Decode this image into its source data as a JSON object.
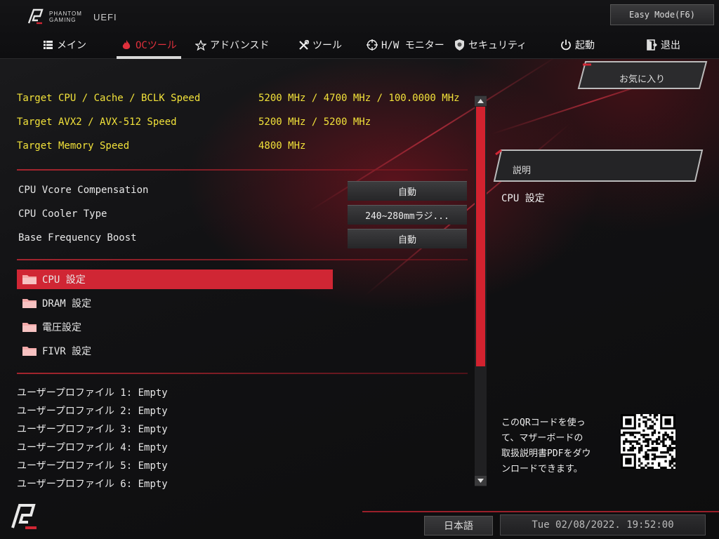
{
  "header": {
    "logo_brand_line1": "PHANTOM",
    "logo_brand_line2": "GAMING",
    "logo_uefi": "UEFI",
    "easy_mode_label": "Easy Mode(F6)"
  },
  "nav": {
    "tabs": [
      {
        "label": "メイン",
        "icon": "list-icon",
        "active": false
      },
      {
        "label": "OCツール",
        "icon": "flame-icon",
        "active": true
      },
      {
        "label": "アドバンスド",
        "icon": "star-icon",
        "active": false
      },
      {
        "label": "ツール",
        "icon": "tools-icon",
        "active": false
      },
      {
        "label": "H/W モニター",
        "icon": "crosshair-icon",
        "active": false
      },
      {
        "label": "セキュリティ",
        "icon": "shield-icon",
        "active": false
      },
      {
        "label": "起動",
        "icon": "power-icon",
        "active": false
      },
      {
        "label": "退出",
        "icon": "exit-icon",
        "active": false
      }
    ]
  },
  "targets": [
    {
      "label": "Target CPU / Cache / BCLK Speed",
      "value": "5200 MHz / 4700 MHz / 100.0000 MHz"
    },
    {
      "label": "Target AVX2 / AVX-512 Speed",
      "value": "5200 MHz / 5200 MHz"
    },
    {
      "label": "Target Memory Speed",
      "value": "4800 MHz"
    }
  ],
  "settings": [
    {
      "label": "CPU Vcore Compensation",
      "value": "自動"
    },
    {
      "label": "CPU Cooler Type",
      "value": "240~280mmラジ..."
    },
    {
      "label": "Base Frequency Boost",
      "value": "自動"
    }
  ],
  "submenus": [
    {
      "label": "CPU 設定",
      "selected": true
    },
    {
      "label": "DRAM 設定",
      "selected": false
    },
    {
      "label": "電圧設定",
      "selected": false
    },
    {
      "label": "FIVR 設定",
      "selected": false
    }
  ],
  "profiles": [
    "ユーザープロファイル 1: Empty",
    "ユーザープロファイル 2: Empty",
    "ユーザープロファイル 3: Empty",
    "ユーザープロファイル 4: Empty",
    "ユーザープロファイル 5: Empty",
    "ユーザープロファイル 6: Empty"
  ],
  "right_panel": {
    "favorites_label": "お気に入り",
    "description_label": "説明",
    "description_text": "CPU 設定",
    "qr_text_lines": [
      "このQRコードを使っ",
      "て、マザーボードの",
      "取扱説明書PDFをダウ",
      "ンロードできます。"
    ]
  },
  "footer": {
    "language": "日本語",
    "datetime": "Tue 02/08/2022. 19:52:00"
  },
  "colors": {
    "accent_red": "#d02634",
    "target_yellow": "#f2e23a",
    "active_tab": "#e0303c"
  }
}
